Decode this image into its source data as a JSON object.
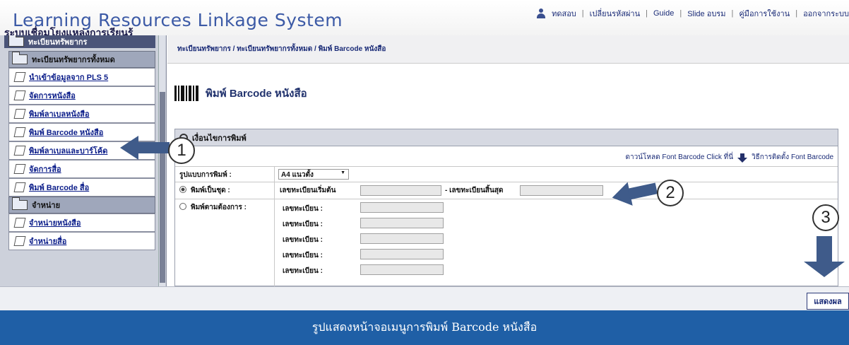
{
  "header": {
    "title": "Learning Resources Linkage System",
    "subtitle": "ระบบเชื่อมโยงแหล่งการเรียนรู้",
    "links": [
      "ทดสอบ",
      "เปลี่ยนรหัสผ่าน",
      "Guide",
      "Slide อบรม",
      "คู่มือการใช้งาน",
      "ออกจากระบบ"
    ]
  },
  "sidebar": {
    "top_group": "ทะเบียนทรัพยากร",
    "groups": [
      "ทะเบียนทรัพยากรทั้งหมด",
      "จำหน่าย"
    ],
    "items": [
      "นำเข้าข้อมูลจาก PLS 5",
      "จัดการหนังสือ",
      "พิมพ์ลาเบลหนังสือ",
      "พิมพ์ Barcode หนังสือ",
      "พิมพ์ลาเบลและบาร์โค้ด",
      "จัดการสื่อ",
      "พิมพ์ Barcode สื่อ",
      "จำหน่ายหนังสือ",
      "จำหน่ายสื่อ"
    ]
  },
  "main": {
    "breadcrumb": "ทะเบียนทรัพยากร / ทะเบียนทรัพยากรทั้งหมด / พิมพ์ Barcode หนังสือ",
    "page_title": "พิมพ์ Barcode หนังสือ",
    "options_header": "เงื่อนไขการพิมพ์",
    "download_text": "ดาวน์โหลด Font Barcode Click ที่นี่",
    "install_text": "วิธีการติดตั้ง Font Barcode",
    "print_format_label": "รูปแบบการพิมพ์ :",
    "print_format_value": "A4 แนวตั้ง",
    "print_set_label": "พิมพ์เป็นชุด :",
    "start_reg_label": "เลขทะเบียนเริ่มต้น",
    "end_reg_label": "- เลขทะเบียนสิ้นสุด",
    "print_custom_label": "พิมพ์ตามต้องการ :",
    "reg_label": "เลขทะเบียน :"
  },
  "footer": {
    "show_button": "แสดงผล",
    "caption": "รูปแสดงหน้าจอเมนูการพิมพ์ Barcode หนังสือ"
  },
  "annotations": [
    "1",
    "2",
    "3"
  ],
  "colors": {
    "accent": "#1f5fa6",
    "arrow": "#3f5b8a",
    "title": "#3c5aa6"
  }
}
